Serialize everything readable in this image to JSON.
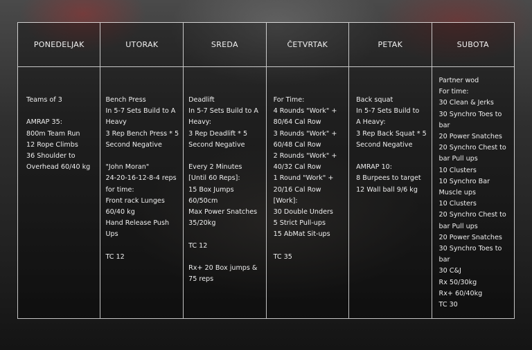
{
  "days": [
    {
      "name": "PONEDELJAK",
      "lines": [
        "Teams of 3",
        "",
        "AMRAP 35:",
        "800m Team Run",
        "12 Rope Climbs",
        "36 Shoulder to",
        "Overhead 60/40 kg"
      ]
    },
    {
      "name": "UTORAK",
      "lines": [
        "Bench Press",
        "In 5-7 Sets Build to A",
        "Heavy",
        "3 Rep Bench Press * 5",
        "Second Negative",
        "",
        "\"John Moran\"",
        "24-20-16-12-8-4 reps",
        "for time:",
        "Front rack Lunges",
        "60/40 kg",
        "Hand Release Push",
        "Ups",
        "",
        "TC 12"
      ]
    },
    {
      "name": "SREDA",
      "lines": [
        "Deadlift",
        "In 5-7 Sets Build to A",
        "Heavy:",
        "3 Rep Deadlift * 5",
        "Second Negative",
        "",
        "Every 2 Minutes",
        "[Until 60 Reps]:",
        "15 Box Jumps",
        "60/50cm",
        "Max Power Snatches",
        "35/20kg",
        "",
        "TC 12",
        "",
        "Rx+ 20 Box jumps &",
        "75 reps"
      ]
    },
    {
      "name": "ČETVRTAK",
      "lines": [
        "For Time:",
        "4 Rounds \"Work\" +",
        "80/64 Cal Row",
        "3 Rounds \"Work\" +",
        "60/48 Cal Row",
        "2 Rounds \"Work\" +",
        "40/32 Cal Row",
        "1 Round \"Work\" +",
        "20/16 Cal Row",
        "[Work]:",
        "30 Double Unders",
        "5 Strict Pull-ups",
        "15 AbMat Sit-ups",
        "",
        "TC 35"
      ]
    },
    {
      "name": "PETAK",
      "lines": [
        "Back squat",
        "In 5-7 Sets Build to",
        "A Heavy:",
        "3 Rep Back Squat * 5",
        "Second Negative",
        "",
        "AMRAP 10:",
        "8 Burpees to target",
        "12 Wall ball 9/6 kg"
      ]
    },
    {
      "name": "SUBOTA",
      "lines": [
        "Partner wod",
        "For time:",
        "30 Clean & Jerks",
        "30 Synchro Toes to",
        "bar",
        "20 Power Snatches",
        "20 Synchro Chest to",
        "bar Pull ups",
        "10 Clusters",
        "10 Synchro Bar",
        "Muscle ups",
        "10 Clusters",
        "20 Synchro Chest to",
        "bar Pull ups",
        "20 Power Snatches",
        "30 Synchro Toes to",
        "bar",
        "30 C&J",
        "Rx 50/30kg",
        "Rx+ 60/40kg",
        "TC 30"
      ]
    }
  ]
}
